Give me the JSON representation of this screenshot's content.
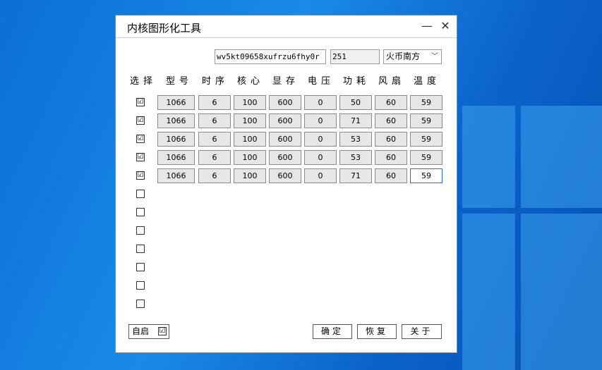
{
  "window": {
    "title": "内核图形化工具"
  },
  "top_fields": {
    "serial": "wv5kt09658xufrzu6fhy0r",
    "number": "251",
    "preset": "火币南方"
  },
  "columns": [
    "选择",
    "型号",
    "时序",
    "核心",
    "显存",
    "电压",
    "功耗",
    "风扇",
    "温度"
  ],
  "rows": [
    {
      "checked": true,
      "values": [
        "1066",
        "6",
        "100",
        "600",
        "0",
        "50",
        "60",
        "59"
      ]
    },
    {
      "checked": true,
      "values": [
        "1066",
        "6",
        "100",
        "600",
        "0",
        "71",
        "60",
        "59"
      ]
    },
    {
      "checked": true,
      "values": [
        "1066",
        "6",
        "100",
        "600",
        "0",
        "53",
        "60",
        "59"
      ]
    },
    {
      "checked": true,
      "values": [
        "1066",
        "6",
        "100",
        "600",
        "0",
        "53",
        "60",
        "59"
      ]
    },
    {
      "checked": true,
      "values": [
        "1066",
        "6",
        "100",
        "600",
        "0",
        "71",
        "60",
        "59"
      ]
    },
    {
      "checked": false,
      "values": []
    },
    {
      "checked": false,
      "values": []
    },
    {
      "checked": false,
      "values": []
    },
    {
      "checked": false,
      "values": []
    },
    {
      "checked": false,
      "values": []
    },
    {
      "checked": false,
      "values": []
    },
    {
      "checked": false,
      "values": []
    }
  ],
  "footer": {
    "autostart": "自启",
    "confirm": "确定",
    "restore": "恢复",
    "about": "关于"
  },
  "check_glyph": "☑"
}
